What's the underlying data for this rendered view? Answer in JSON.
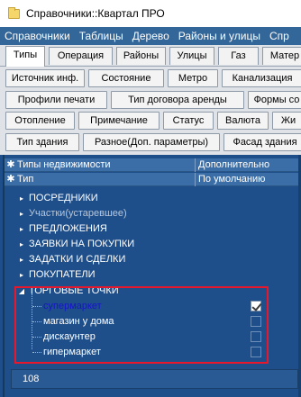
{
  "window": {
    "title": "Справочники::Квартал ПРО"
  },
  "menu": [
    "Справочники",
    "Таблицы",
    "Дерево",
    "Районы и улицы",
    "Спр"
  ],
  "tabs": [
    {
      "label": "Типы",
      "active": true
    },
    {
      "label": "Операция"
    },
    {
      "label": "Районы"
    },
    {
      "label": "Улицы"
    },
    {
      "label": "Газ"
    },
    {
      "label": "Матер"
    }
  ],
  "button_rows": [
    [
      "Источник инф.",
      "Состояние",
      "Метро",
      "Канализация"
    ],
    [
      "Профили печати",
      "Тип договора аренды",
      "Формы со"
    ],
    [
      "Отопление",
      "Примечание",
      "Статус",
      "Валюта",
      "Жи"
    ],
    [
      "Тип здания",
      "Разное(Доп. параметры)",
      "Фасад здания"
    ]
  ],
  "grid": {
    "header1": {
      "col1": "Типы недвижимости",
      "col2": "Дополнительно"
    },
    "header2": {
      "col1": "Тип",
      "col2": "По умолчанию"
    },
    "rows": [
      {
        "label": "ПОСРЕДНИКИ",
        "dim": false
      },
      {
        "label": "Участки(устаревшее)",
        "dim": true
      },
      {
        "label": "ПРЕДЛОЖЕНИЯ",
        "dim": false
      },
      {
        "label": "ЗАЯВКИ НА ПОКУПКИ",
        "dim": false
      },
      {
        "label": "ЗАДАТКИ И СДЕЛКИ",
        "dim": false
      },
      {
        "label": "ПОКУПАТЕЛИ",
        "dim": false
      },
      {
        "label": "ТОРГОВЫЕ ТОЧКИ",
        "expanded": true
      }
    ],
    "children": [
      {
        "label": "супермаркет",
        "checked": true,
        "selected": true
      },
      {
        "label": "магазин у дома",
        "checked": false
      },
      {
        "label": "дискаунтер",
        "checked": false
      },
      {
        "label": "гипермаркет",
        "checked": false
      }
    ],
    "footer_count": "108"
  },
  "colors": {
    "menubar": "#336699",
    "grid_bg": "#1f4f8a",
    "highlight": "#e8172b",
    "selected_text": "#1515c8"
  }
}
